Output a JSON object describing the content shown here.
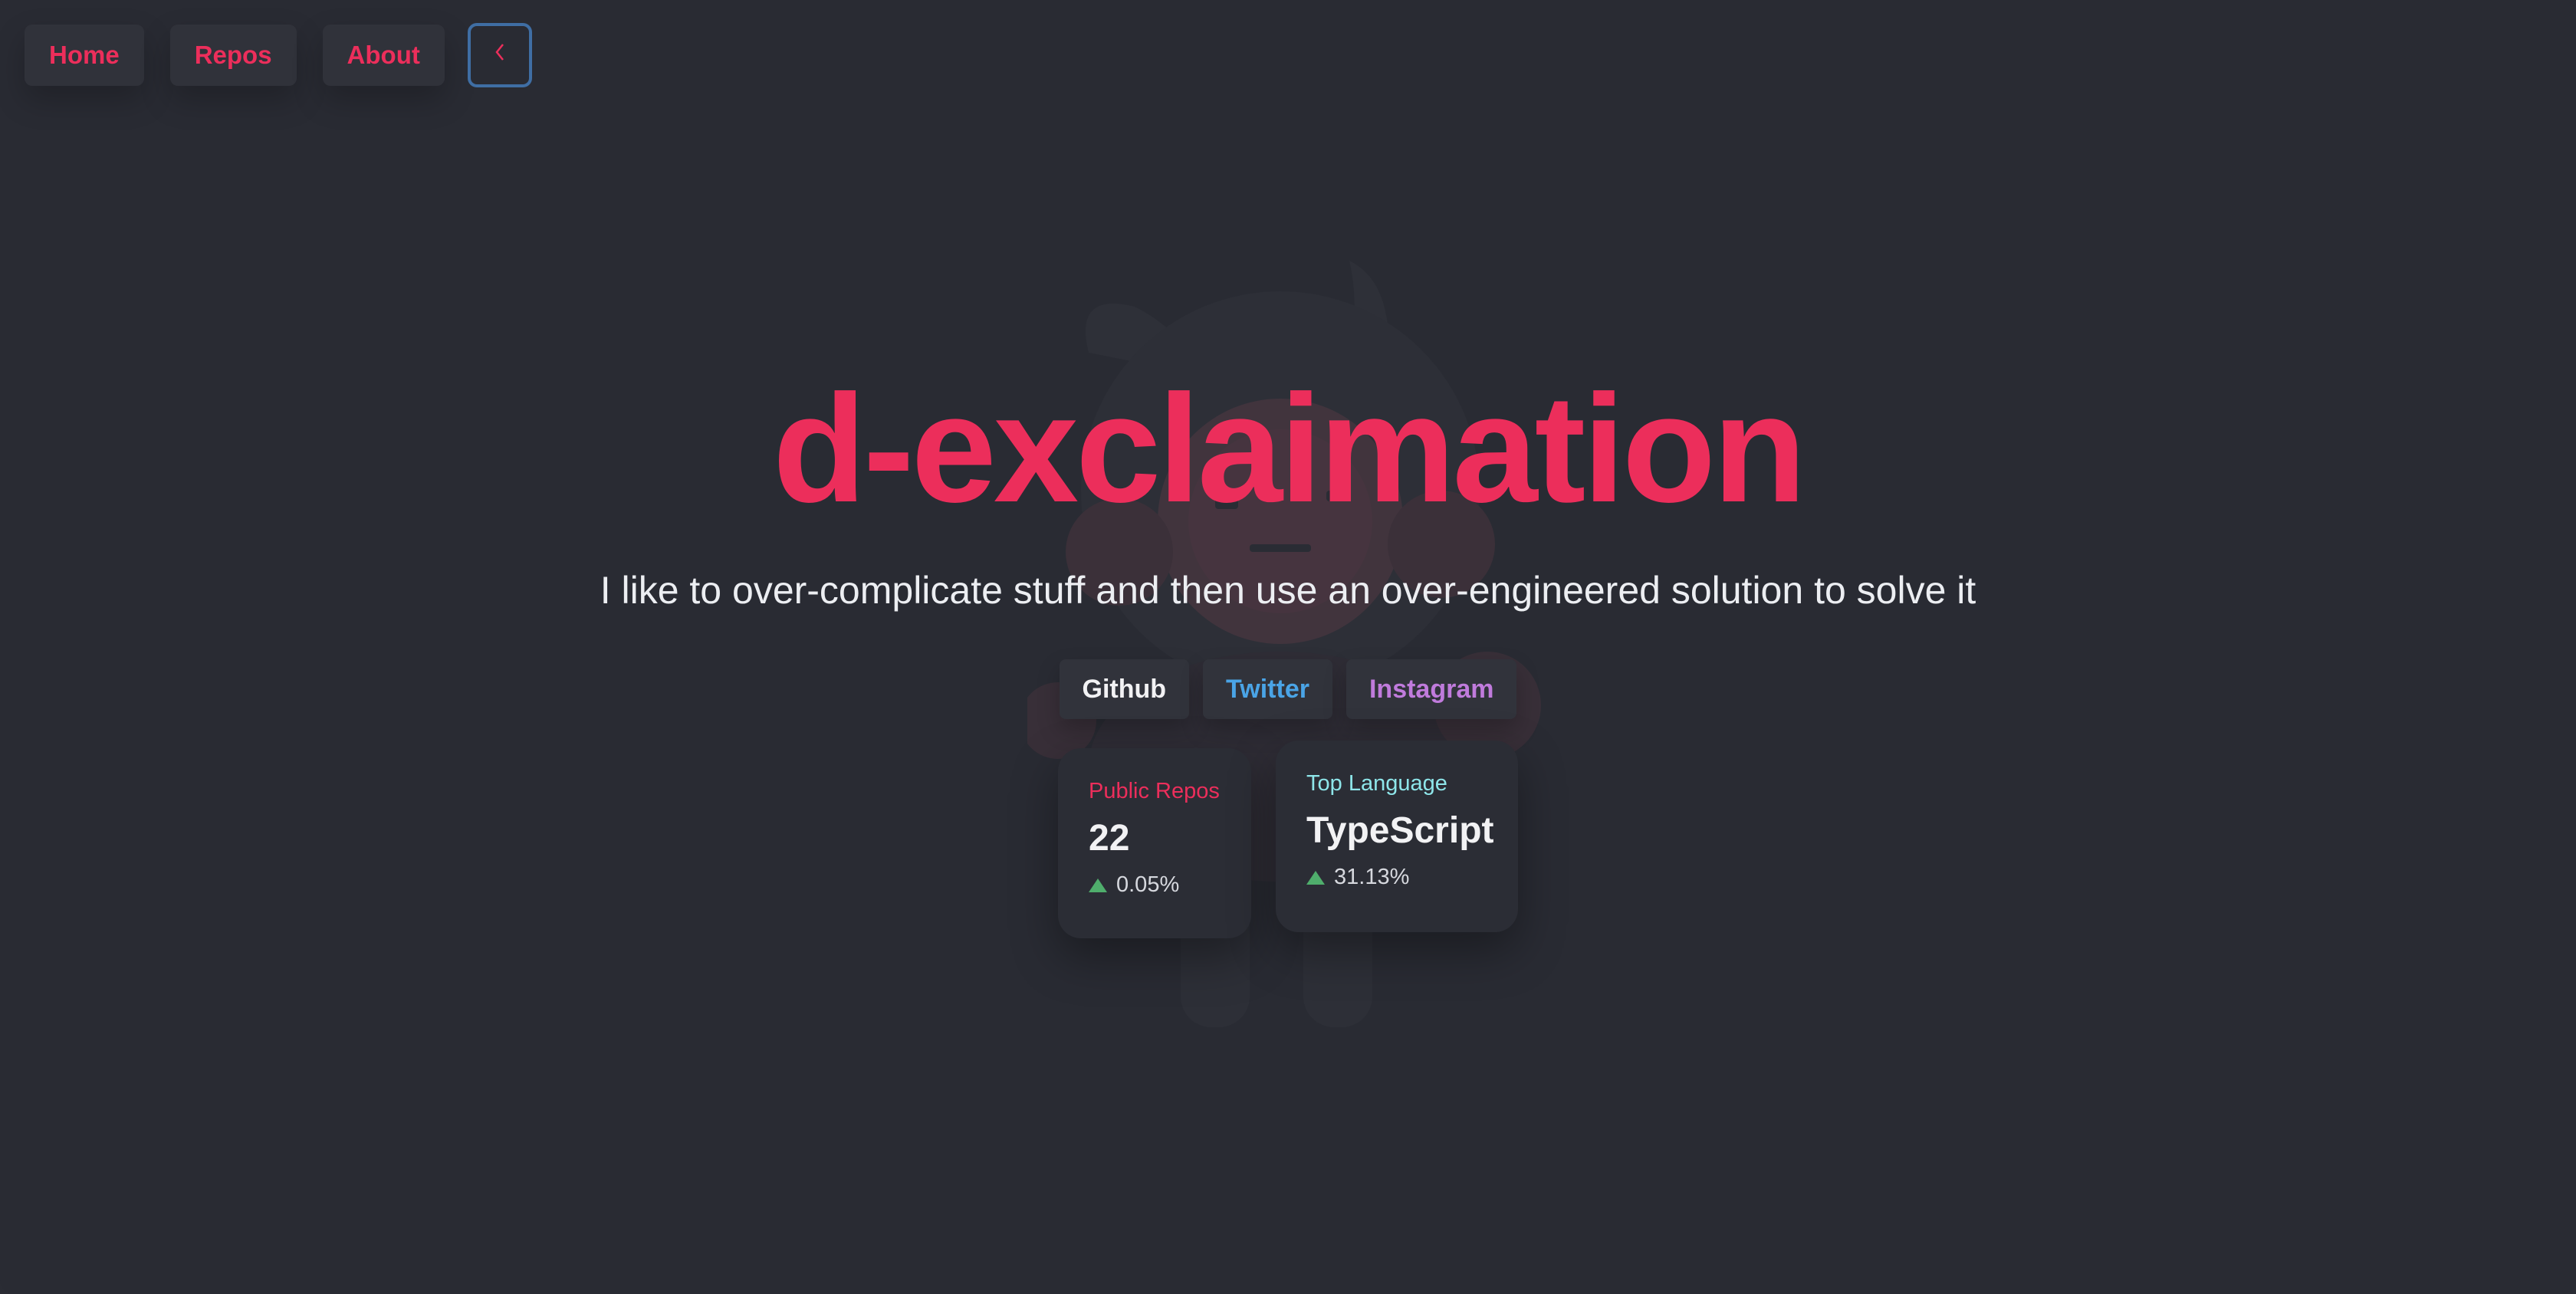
{
  "nav": {
    "home_label": "Home",
    "repos_label": "Repos",
    "about_label": "About",
    "toggle_icon": "chevron-left-icon"
  },
  "hero": {
    "title": "d-exclaimation",
    "subtitle": "I like to over-complicate stuff and then use an over-engineered solution to solve it"
  },
  "social": {
    "github_label": "Github",
    "twitter_label": "Twitter",
    "instagram_label": "Instagram"
  },
  "stats": {
    "repos": {
      "label": "Public Repos",
      "value": "22",
      "change": "0.05%"
    },
    "language": {
      "label": "Top Language",
      "value": "TypeScript",
      "change": "31.13%"
    }
  },
  "colors": {
    "background": "#292b33",
    "accent": "#ec2e5b",
    "twitter": "#4aa4e6",
    "instagram": "#c07bdc",
    "language_label": "#8ee6ea",
    "up": "#4fae6c"
  }
}
